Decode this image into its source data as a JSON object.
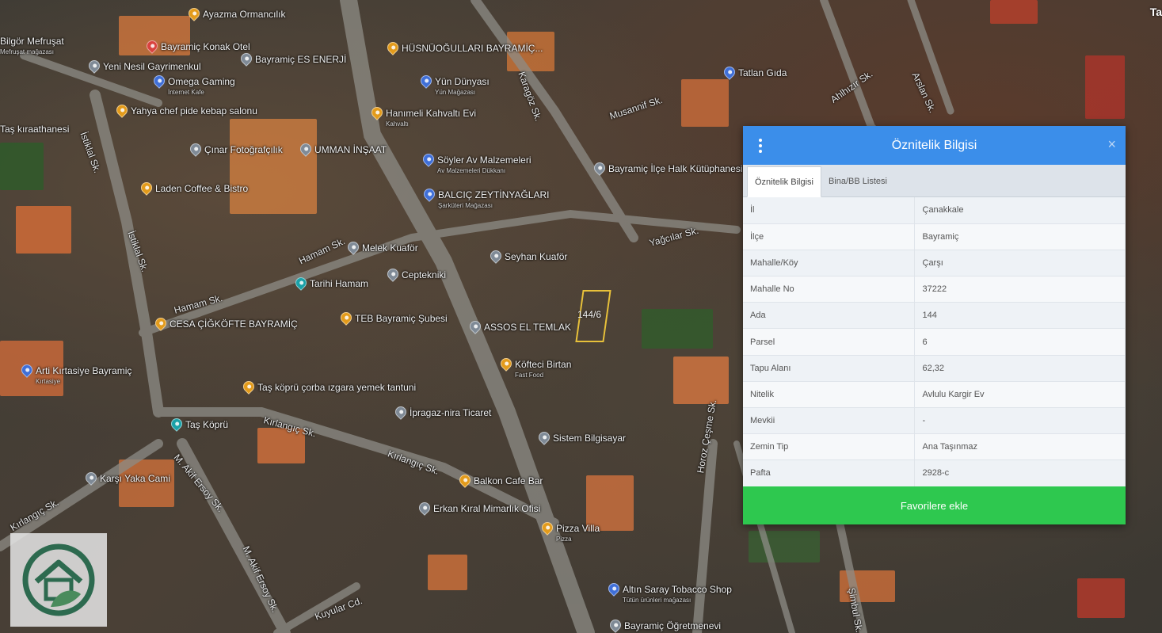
{
  "top_right_text": "Ta",
  "map": {
    "parcel_label": "144/6",
    "places": [
      {
        "name": "Ayazma Ormancılık",
        "sub": "",
        "icon": "orange-pin"
      },
      {
        "name": "Bayramiç Konak Otel",
        "sub": "",
        "icon": "red-pin"
      },
      {
        "name": "Bayramiç ES ENERJİ",
        "sub": "",
        "icon": "grey-pin"
      },
      {
        "name": "HÜSNÜOĞULLARI BAYRAMİÇ...",
        "sub": "",
        "icon": "orange-pin"
      },
      {
        "name": "Yeni Nesil Gayrimenkul",
        "sub": "",
        "icon": "grey-pin"
      },
      {
        "name": "Omega Gaming",
        "sub": "İnternet Kafe",
        "icon": "blue-pin"
      },
      {
        "name": "Yün Dünyası",
        "sub": "Yün Mağazası",
        "icon": "blue-pin"
      },
      {
        "name": "Tatlan Gıda",
        "sub": "",
        "icon": "blue-pin"
      },
      {
        "name": "Yahya chef pide kebap salonu",
        "sub": "",
        "icon": "orange-pin"
      },
      {
        "name": "Hanımeli Kahvaltı Evi",
        "sub": "Kahvaltı",
        "icon": "orange-pin"
      },
      {
        "name": "Taş kıraathanesi",
        "sub": "",
        "icon": "orange-pin"
      },
      {
        "name": "Çınar Fotoğrafçılık",
        "sub": "",
        "icon": "grey-pin"
      },
      {
        "name": "UMMAN İNŞAAT",
        "sub": "",
        "icon": "grey-pin"
      },
      {
        "name": "Söyler Av Malzemeleri",
        "sub": "Av Malzemeleri Dükkanı",
        "icon": "blue-pin"
      },
      {
        "name": "Bayramiç İlçe Halk Kütüphanesi ve Kitap Kafe",
        "sub": "",
        "icon": "grey-pin"
      },
      {
        "name": "Laden Coffee & Bistro",
        "sub": "",
        "icon": "orange-pin"
      },
      {
        "name": "BALCIÇ ZEYTİNYAĞLARI",
        "sub": "Şarküteri Mağazası",
        "icon": "blue-pin"
      },
      {
        "name": "Melek Kuaför",
        "sub": "",
        "icon": "grey-pin"
      },
      {
        "name": "Seyhan Kuaför",
        "sub": "",
        "icon": "grey-pin"
      },
      {
        "name": "Tarihi Hamam",
        "sub": "",
        "icon": "teal-pin"
      },
      {
        "name": "Ceptekniki",
        "sub": "",
        "icon": "grey-pin"
      },
      {
        "name": "CESA ÇİĞKÖFTE BAYRAMİÇ",
        "sub": "",
        "icon": "orange-pin"
      },
      {
        "name": "TEB Bayramiç Şubesi",
        "sub": "",
        "icon": "orange-pin"
      },
      {
        "name": "ASSOS EL TEMLAK",
        "sub": "",
        "icon": "grey-pin"
      },
      {
        "name": "Arti Kırtasiye Bayramiç",
        "sub": "Kırtasiye",
        "icon": "blue-pin"
      },
      {
        "name": "Köfteci Birtan",
        "sub": "Fast Food",
        "icon": "orange-pin"
      },
      {
        "name": "Taş köprü çorba ızgara yemek tantuni",
        "sub": "",
        "icon": "orange-pin"
      },
      {
        "name": "İpragaz-nira Ticaret",
        "sub": "",
        "icon": "grey-pin"
      },
      {
        "name": "Taş Köprü",
        "sub": "",
        "icon": "teal-pin"
      },
      {
        "name": "Sistem Bilgisayar",
        "sub": "",
        "icon": "grey-pin"
      },
      {
        "name": "Karşı Yaka Cami",
        "sub": "",
        "icon": "grey-pin"
      },
      {
        "name": "Balkon Cafe Bar",
        "sub": "",
        "icon": "orange-pin"
      },
      {
        "name": "Erkan Kıral Mimarlık Ofisi",
        "sub": "",
        "icon": "grey-pin"
      },
      {
        "name": "Pizza Villa",
        "sub": "Pizza",
        "icon": "orange-pin"
      },
      {
        "name": "Altın Saray Tobacco Shop",
        "sub": "Tütün ürünleri mağazası",
        "icon": "blue-pin"
      },
      {
        "name": "Bayramiç Öğretmenevi",
        "sub": "",
        "icon": "grey-pin"
      },
      {
        "name": "Bilgör Mefruşat",
        "sub": "Mefruşat mağazası",
        "icon": "blue-pin"
      }
    ],
    "streets": [
      "Karagöz Sk.",
      "Musannif Sk.",
      "Ahlhızır Sk.",
      "Arslan Sk.",
      "İstiklal Sk.",
      "İstiklal Sk.",
      "Hamam Sk.",
      "Hamam Sk.",
      "Yağcılar Sk.",
      "Kırlangıç Sk.",
      "Kırlangıç Sk.",
      "Kırlangıç Sk.",
      "M. Akif Ersoy Sk.",
      "M. Akif Ersoy Sk.",
      "Horoz Çeşme Sk.",
      "Kuyular Cd.",
      "Şimbul Sk."
    ]
  },
  "panel": {
    "title": "Öznitelik Bilgisi",
    "tabs": [
      {
        "label": "Öznitelik Bilgisi",
        "active": true
      },
      {
        "label": "Bina/BB Listesi",
        "active": false
      }
    ],
    "rows": [
      {
        "key": "İl",
        "value": "Çanakkale"
      },
      {
        "key": "İlçe",
        "value": "Bayramiç"
      },
      {
        "key": "Mahalle/Köy",
        "value": "Çarşı"
      },
      {
        "key": "Mahalle No",
        "value": "37222"
      },
      {
        "key": "Ada",
        "value": "144"
      },
      {
        "key": "Parsel",
        "value": "6"
      },
      {
        "key": "Tapu Alanı",
        "value": "62,32"
      },
      {
        "key": "Nitelik",
        "value": "Avlulu Kargir Ev"
      },
      {
        "key": "Mevkii",
        "value": "-"
      },
      {
        "key": "Zemin Tip",
        "value": "Ana Taşınmaz"
      },
      {
        "key": "Pafta",
        "value": "2928-c"
      }
    ],
    "favorite_label": "Favorilere ekle",
    "close_label": "×"
  },
  "colors": {
    "header_blue": "#3b8eea",
    "favorite_green": "#2ec84f",
    "parcel_outline": "#e8c13a"
  }
}
